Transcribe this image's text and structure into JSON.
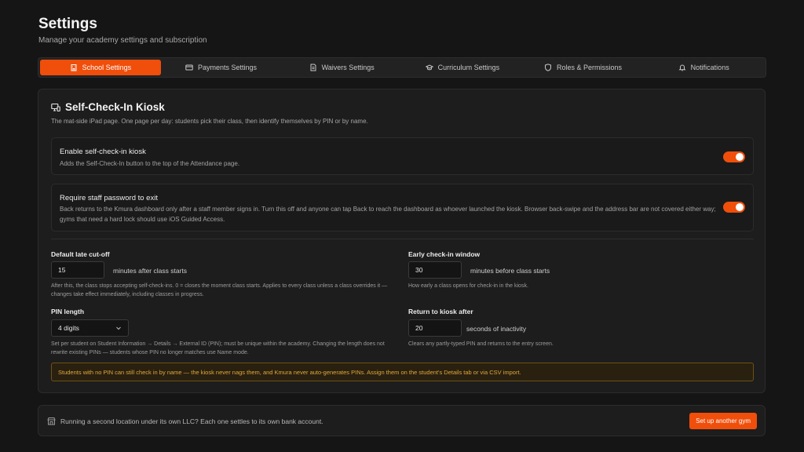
{
  "page": {
    "title": "Settings",
    "subtitle": "Manage your academy settings and subscription"
  },
  "tabs": [
    {
      "label": "School Settings",
      "icon": "building-icon",
      "active": true
    },
    {
      "label": "Payments Settings",
      "icon": "credit-card-icon",
      "active": false
    },
    {
      "label": "Waivers Settings",
      "icon": "document-icon",
      "active": false
    },
    {
      "label": "Curriculum Settings",
      "icon": "graduation-cap-icon",
      "active": false
    },
    {
      "label": "Roles & Permissions",
      "icon": "shield-icon",
      "active": false
    },
    {
      "label": "Notifications",
      "icon": "bell-icon",
      "active": false
    }
  ],
  "kiosk": {
    "title": "Self-Check-In Kiosk",
    "description": "The mat-side iPad page. One page per day: students pick their class, then identify themselves by PIN or by name.",
    "enable": {
      "title": "Enable self-check-in kiosk",
      "description": "Adds the Self-Check-In button to the top of the Attendance page.",
      "on": true
    },
    "require_password": {
      "title": "Require staff password to exit",
      "description": "Back returns to the Kmura dashboard only after a staff member signs in. Turn this off and anyone can tap Back to reach the dashboard as whoever launched the kiosk. Browser back-swipe and the address bar are not covered either way; gyms that need a hard lock should use iOS Guided Access.",
      "on": true
    },
    "late_cutoff": {
      "label": "Default late cut-off",
      "value": "15",
      "suffix": "minutes after class starts",
      "help": "After this, the class stops accepting self-check-ins. 0 = closes the moment class starts. Applies to every class unless a class overrides it — changes take effect immediately, including classes in progress."
    },
    "early_window": {
      "label": "Early check-in window",
      "value": "30",
      "suffix": "minutes before class starts",
      "help": "How early a class opens for check-in in the kiosk."
    },
    "pin_length": {
      "label": "PIN length",
      "value": "4 digits",
      "help": "Set per student on Student Information → Details → External ID (PIN); must be unique within the academy. Changing the length does not rewrite existing PINs — students whose PIN no longer matches use Name mode."
    },
    "return_after": {
      "label": "Return to kiosk after",
      "value": "20",
      "suffix": "seconds of inactivity",
      "help": "Clears any partly-typed PIN and returns to the entry screen."
    },
    "notice": "Students with no PIN can still check in by name — the kiosk never nags them, and Kmura never auto-generates PINs. Assign them on the student's Details tab or via CSV import."
  },
  "footer": {
    "text": "Running a second location under its own LLC? Each one settles to its own bank account.",
    "button": "Set up another gym"
  },
  "colors": {
    "accent": "#f04e0b",
    "notice_text": "#e0a93a",
    "notice_border": "#6b5315"
  }
}
